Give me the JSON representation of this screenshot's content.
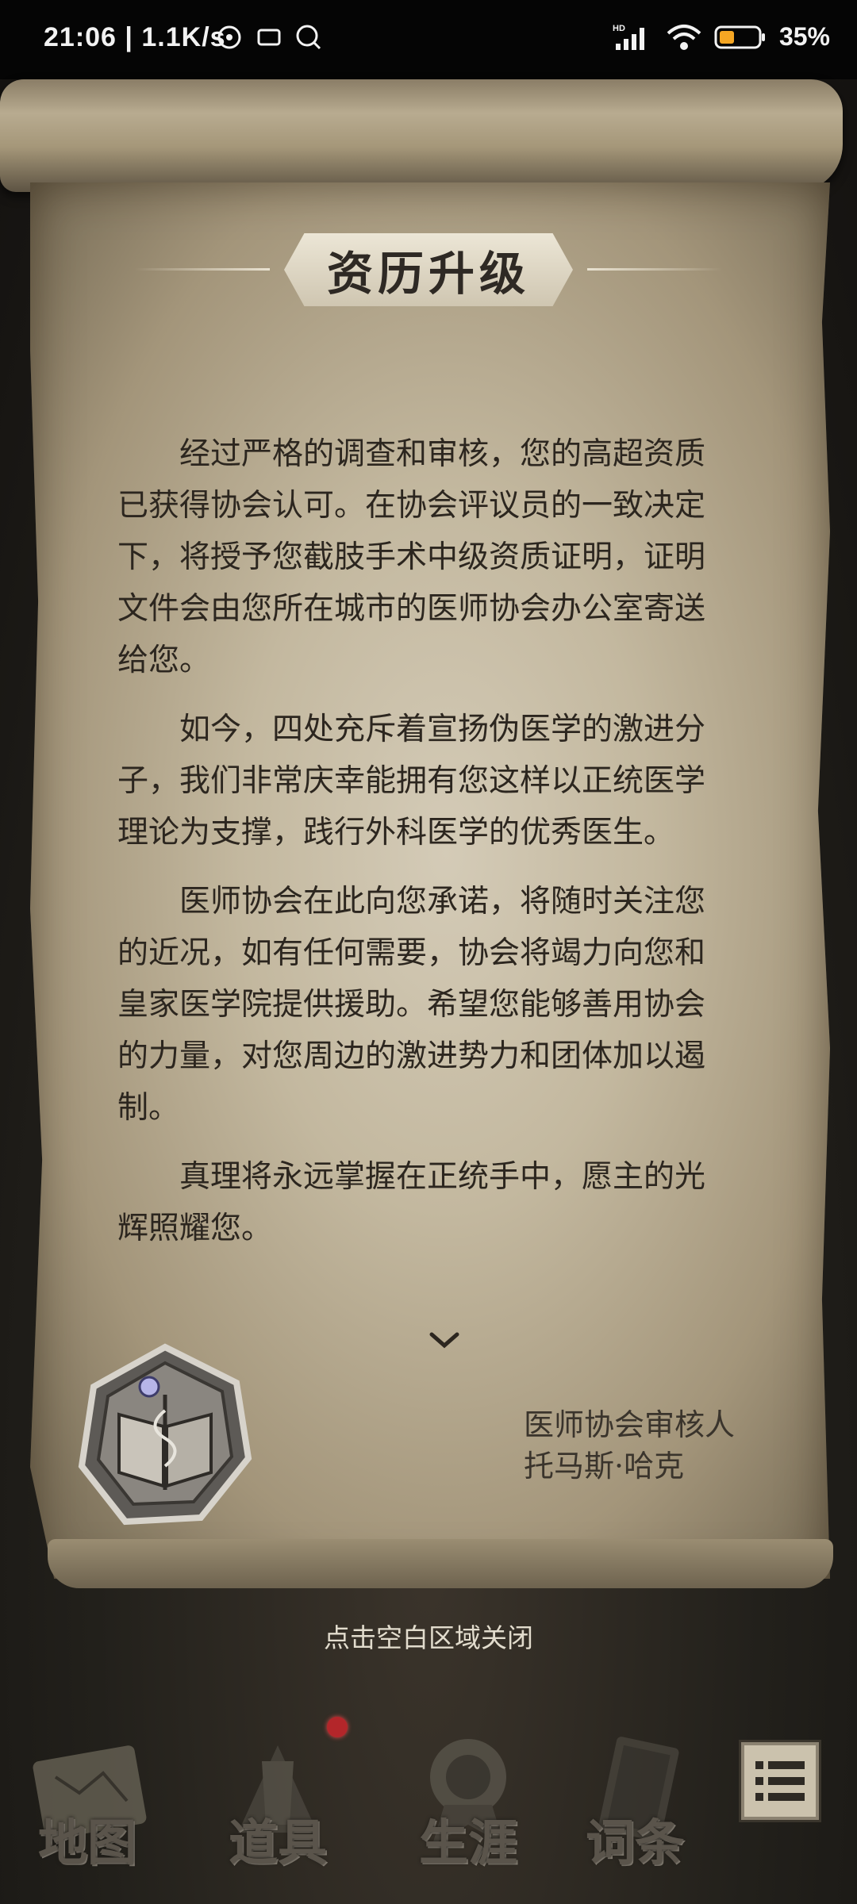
{
  "status_bar": {
    "time": "21:06",
    "speed": "| 1.1K/s",
    "network_label": "HD",
    "battery": "35%",
    "battery_color": "#f5a623"
  },
  "letter": {
    "title": "资历升级",
    "paragraphs": [
      "经过严格的调查和审核，您的高超资质已获得协会认可。在协会评议员的一致决定下，将授予您截肢手术中级资质证明，证明文件会由您所在城市的医师协会办公室寄送给您。",
      "如今，四处充斥着宣扬伪医学的激进分子，我们非常庆幸能拥有您这样以正统医学理论为支撑，践行外科医学的优秀医生。",
      "医师协会在此向您承诺，将随时关注您的近况，如有任何需要，协会将竭力向您和皇家医学院提供援助。希望您能够善用协会的力量，对您周边的激进势力和团体加以遏制。",
      "真理将永远掌握在正统手中，愿主的光辉照耀您。"
    ],
    "signer_title": "医师协会审核人",
    "signer_name": "托马斯·哈克",
    "seal_icon": "association-seal-icon",
    "more_icon": "chevron-down-icon"
  },
  "close_hint": "点击空白区域关闭",
  "nav": {
    "items": [
      {
        "label": "地图",
        "icon": "map-icon"
      },
      {
        "label": "道具",
        "icon": "items-icon"
      },
      {
        "label": "生涯",
        "icon": "career-icon"
      },
      {
        "label": "词条",
        "icon": "book-icon"
      }
    ],
    "menu_icon": "list-menu-icon",
    "notification_color": "#b3262a"
  }
}
